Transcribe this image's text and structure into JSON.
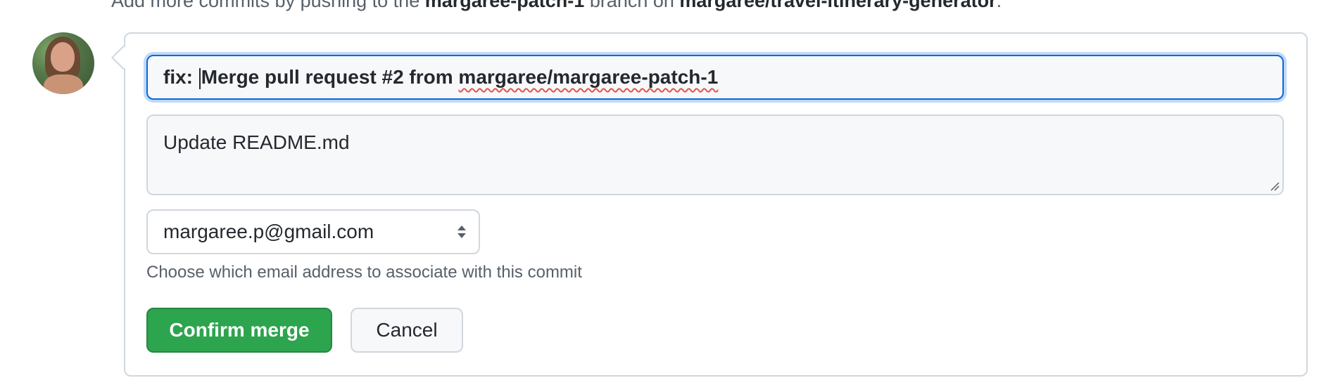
{
  "hint_top": {
    "text_prefix": "Add more commits by pushing to the ",
    "branch": "margaree-patch-1",
    "text_mid": " branch on ",
    "repo": "margaree/travel-itinerary-generator",
    "text_suffix": "."
  },
  "avatar": {
    "icon": "user-avatar"
  },
  "merge_form": {
    "title_prefix": "fix: ",
    "title_middle": "Merge pull request #2 from ",
    "title_link": "margaree/margaree-patch-1",
    "body_text": "Update README.md",
    "email_selected": "margaree.p@gmail.com",
    "email_hint": "Choose which email address to associate with this commit",
    "confirm_label": "Confirm merge",
    "cancel_label": "Cancel"
  },
  "colors": {
    "confirm_bg": "#2da44e",
    "focus_border": "#0969da",
    "spell_error": "#e5534b"
  }
}
